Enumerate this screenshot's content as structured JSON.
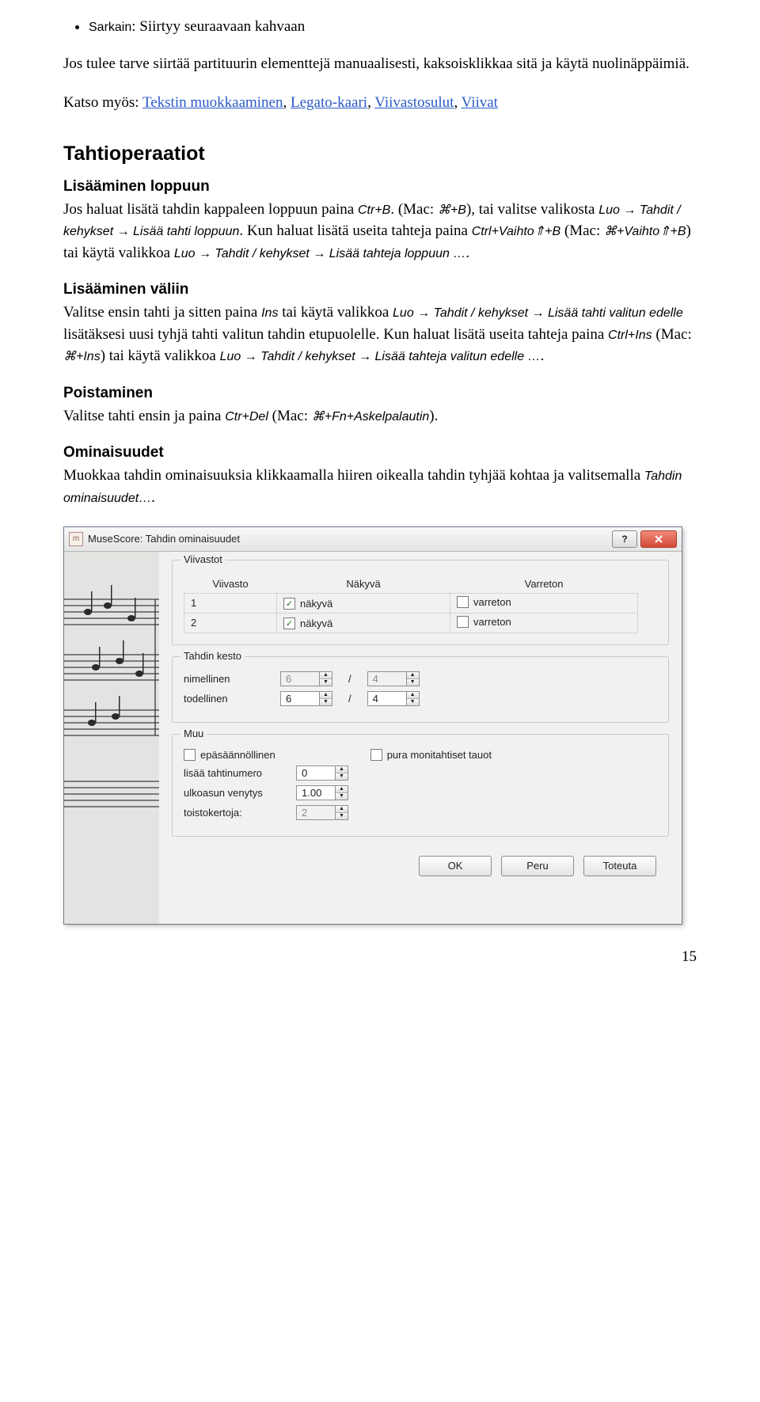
{
  "bullet": {
    "label": "Sarkain",
    "text": ": Siirtyy seuraavaan kahvaan"
  },
  "p_intro": "Jos tulee tarve siirtää partituurin elementtejä manuaalisesti, kaksoisklikkaa sitä ja käytä nuolinäppäimiä.",
  "see_also": {
    "label": "Katso myös: ",
    "links": [
      "Tekstin muokkaaminen",
      "Legato-kaari",
      "Viivastosulut",
      "Viivat"
    ],
    "sep": ", "
  },
  "h2": "Tahtioperaatiot",
  "sec1": {
    "title": "Lisääminen loppuun",
    "t1": "Jos haluat lisätä tahdin kappaleen loppuun paina ",
    "k1": "Ctr+B",
    "t2": ". (Mac: ",
    "k2": "⌘+B",
    "t3": "), tai valitse valikosta ",
    "m1": "Luo → Tahdit / kehykset → Lisää tahti loppuun",
    "t4": ". Kun haluat lisätä useita tahteja paina ",
    "k3": "Ctrl+Vaihto⇑+B",
    "t5": " (Mac: ",
    "k4": "⌘+Vaihto⇑+B",
    "t6": ") tai käytä valikkoa ",
    "m2": "Luo → Tahdit / kehykset → Lisää tahteja loppuun …",
    "t7": "."
  },
  "sec2": {
    "title": "Lisääminen väliin",
    "t1": "Valitse ensin tahti ja sitten paina ",
    "k1": "Ins",
    "t2": " tai käytä valikkoa ",
    "m1": "Luo → Tahdit / kehykset → Lisää tahti valitun edelle",
    "t3": " lisätäksesi uusi tyhjä tahti valitun tahdin etupuolelle. Kun haluat lisätä useita tahteja paina ",
    "k2": "Ctrl+Ins",
    "t4": " (Mac: ",
    "k3": "⌘+Ins",
    "t5": ") tai käytä valikkoa ",
    "m2": "Luo → Tahdit / kehykset → Lisää tahteja valitun edelle …",
    "t6": "."
  },
  "sec3": {
    "title": "Poistaminen",
    "t1": "Valitse tahti ensin ja paina ",
    "k1": "Ctr+Del",
    "t2": " (Mac: ",
    "k2": "⌘+Fn+Askelpalautin",
    "t3": ")."
  },
  "sec4": {
    "title": "Ominaisuudet",
    "t1": "Muokkaa tahdin ominaisuuksia klikkaamalla hiiren oikealla tahdin tyhjää kohtaa ja valitsemalla ",
    "m1": "Tahdin ominaisuudet…",
    "t2": "."
  },
  "dialog": {
    "title": "MuseScore: Tahdin ominaisuudet",
    "help": "?",
    "group_staves": "Viivastot",
    "col1": "Viivasto",
    "col2": "Näkyvä",
    "col3": "Varreton",
    "rows": [
      {
        "n": "1",
        "vis_checked": true,
        "vis_label": "näkyvä",
        "stem_checked": false,
        "stem_label": "varreton"
      },
      {
        "n": "2",
        "vis_checked": true,
        "vis_label": "näkyvä",
        "stem_checked": false,
        "stem_label": "varreton"
      }
    ],
    "group_dur": "Tahdin kesto",
    "nominal": "nimellinen",
    "actual": "todellinen",
    "nom_a": "6",
    "nom_b": "4",
    "act_a": "6",
    "act_b": "4",
    "slash": "/",
    "group_other": "Muu",
    "irregular": "epäsäännöllinen",
    "break": "pura monitahtiset tauot",
    "addnum": "lisää tahtinumero",
    "addnum_v": "0",
    "stretch": "ulkoasun venytys",
    "stretch_v": "1.00",
    "repeat": "toistokertoja:",
    "repeat_v": "2",
    "ok": "OK",
    "cancel": "Peru",
    "apply": "Toteuta"
  },
  "pagenum": "15"
}
